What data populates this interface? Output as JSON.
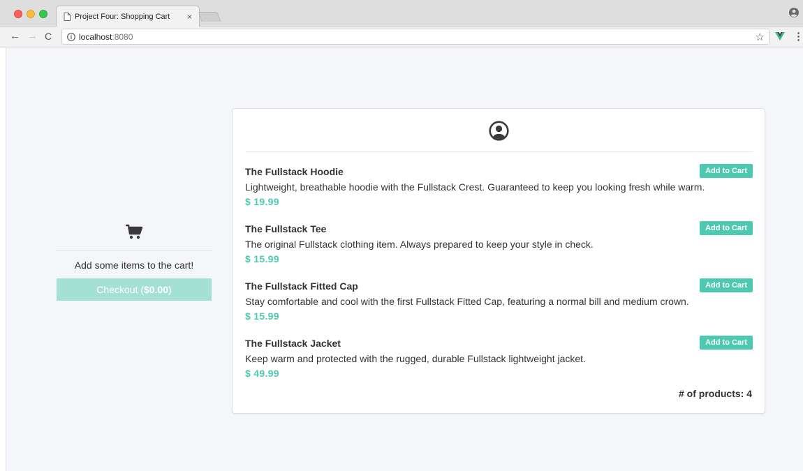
{
  "browser": {
    "tab_title": "Project Four: Shopping Cart",
    "tab_close": "×",
    "url_host": "localhost",
    "url_port": ":8080",
    "back": "←",
    "forward": "→",
    "reload": "C",
    "star": "☆",
    "menu": "⋮"
  },
  "cart": {
    "icon": "shopping-cart-icon",
    "empty_message": "Add some items to the cart!",
    "checkout_label": "Checkout (",
    "checkout_total": "$0.00",
    "checkout_suffix": ")"
  },
  "panel": {
    "icon": "user-circle-icon",
    "products": [
      {
        "name": "The Fullstack Hoodie",
        "description": "Lightweight, breathable hoodie with the Fullstack Crest. Guaranteed to keep you looking fresh while warm.",
        "price": "$ 19.99",
        "button": "Add to Cart"
      },
      {
        "name": "The Fullstack Tee",
        "description": "The original Fullstack clothing item. Always prepared to keep your style in check.",
        "price": "$ 15.99",
        "button": "Add to Cart"
      },
      {
        "name": "The Fullstack Fitted Cap",
        "description": "Stay comfortable and cool with the first Fullstack Fitted Cap, featuring a normal bill and medium crown.",
        "price": "$ 15.99",
        "button": "Add to Cart"
      },
      {
        "name": "The Fullstack Jacket",
        "description": "Keep warm and protected with the rugged, durable Fullstack lightweight jacket.",
        "price": "$ 49.99",
        "button": "Add to Cart"
      }
    ],
    "product_count": "# of products: 4"
  },
  "colors": {
    "accent": "#4dc9b0",
    "checkout_disabled": "#a4e0d3",
    "page_background": "#f4f6fa"
  }
}
